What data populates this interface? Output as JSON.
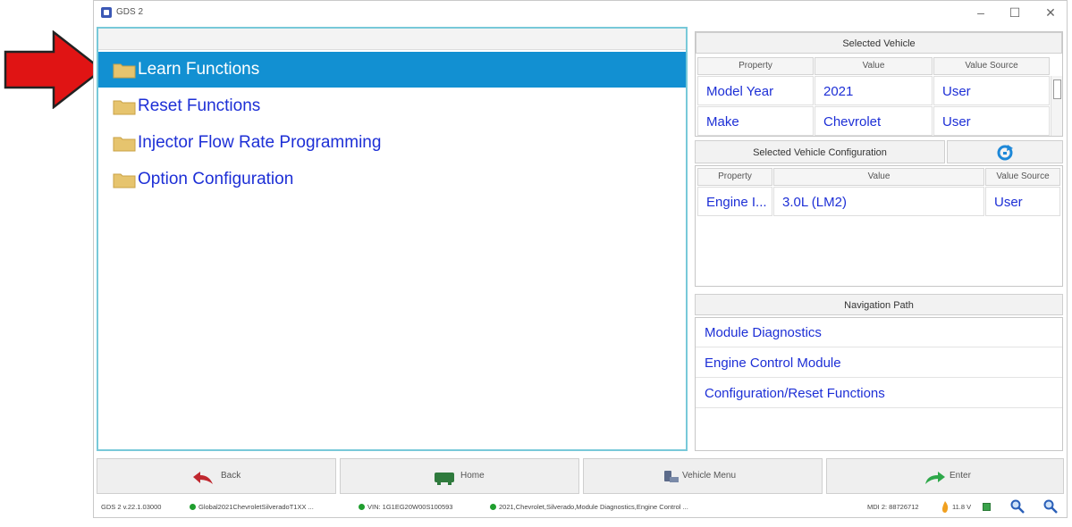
{
  "window": {
    "title": "GDS 2"
  },
  "tree": {
    "items": [
      {
        "label": "Learn Functions"
      },
      {
        "label": "Reset Functions"
      },
      {
        "label": "Injector Flow Rate Programming"
      },
      {
        "label": "Option Configuration"
      }
    ]
  },
  "selected_vehicle": {
    "title": "Selected Vehicle",
    "columns": [
      "Property",
      "Value",
      "Value Source"
    ],
    "rows": [
      [
        "Model Year",
        "2021",
        "User"
      ],
      [
        "Make",
        "Chevrolet",
        "User"
      ]
    ]
  },
  "vehicle_config": {
    "title": "Selected Vehicle Configuration",
    "columns": [
      "Property",
      "Value",
      "Value Source"
    ],
    "rows": [
      [
        "Engine I...",
        "3.0L (LM2)",
        "User"
      ]
    ]
  },
  "navigation": {
    "title": "Navigation Path",
    "items": [
      "Module Diagnostics",
      "Engine Control Module",
      "Configuration/Reset Functions"
    ]
  },
  "buttons": {
    "back": "Back",
    "home": "Home",
    "vehicle_menu": "Vehicle Menu",
    "enter": "Enter"
  },
  "status": {
    "version": "GDS 2 v.22.1.03000",
    "session": "Global2021ChevroletSilveradoT1XX ...",
    "vin": "VIN: 1G1EG20W00S100593",
    "path": "2021,Chevrolet,Silverado,Module Diagnostics,Engine Control ...",
    "mdi": "MDI 2: 88726712",
    "voltage": "11.8 V"
  },
  "colors": {
    "selection": "#1290d2",
    "link": "#1d2fd6",
    "panel_border": "#78c9d9",
    "arrow": "#e01414",
    "status_ok": "#1f9e2e"
  }
}
